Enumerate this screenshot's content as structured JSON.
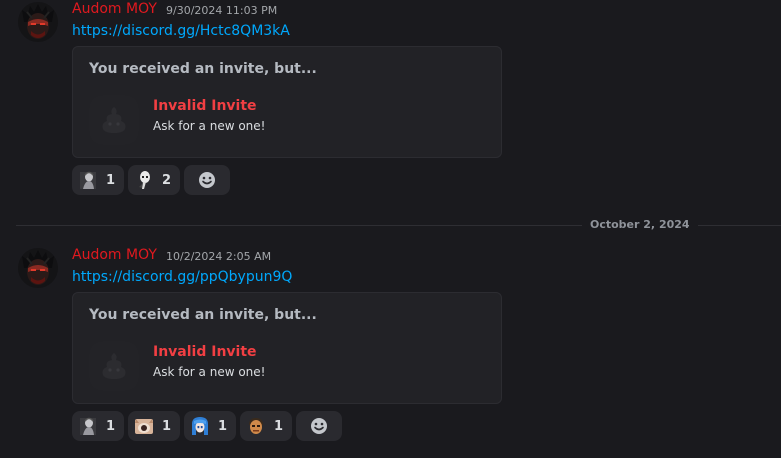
{
  "messages": [
    {
      "author": "Audom MOY",
      "timestamp": "9/30/2024 11:03 PM",
      "link": "https://discord.gg/Hctc8QM3kA",
      "invite": {
        "header": "You received an invite, but...",
        "title": "Invalid Invite",
        "subtitle": "Ask for a new one!"
      },
      "reactions": [
        {
          "emoji": "grey-figure-emoji",
          "count": "1"
        },
        {
          "emoji": "pale-face-emoji",
          "count": "2"
        }
      ]
    },
    {
      "author": "Audom MOY",
      "timestamp": "10/2/2024 2:05 AM",
      "link": "https://discord.gg/ppQbypun9Q",
      "invite": {
        "header": "You received an invite, but...",
        "title": "Invalid Invite",
        "subtitle": "Ask for a new one!"
      },
      "reactions": [
        {
          "emoji": "grey-figure-emoji",
          "count": "1"
        },
        {
          "emoji": "cat-face-emoji",
          "count": "1"
        },
        {
          "emoji": "blue-hair-girl-emoji",
          "count": "1"
        },
        {
          "emoji": "orange-face-emoji",
          "count": "1"
        }
      ]
    }
  ],
  "date_divider": "October 2, 2024",
  "colors": {
    "background": "#1a1a1e",
    "author": "#e0191f",
    "link": "#00a8fc",
    "invalid": "#f23f43",
    "card": "#222226"
  }
}
